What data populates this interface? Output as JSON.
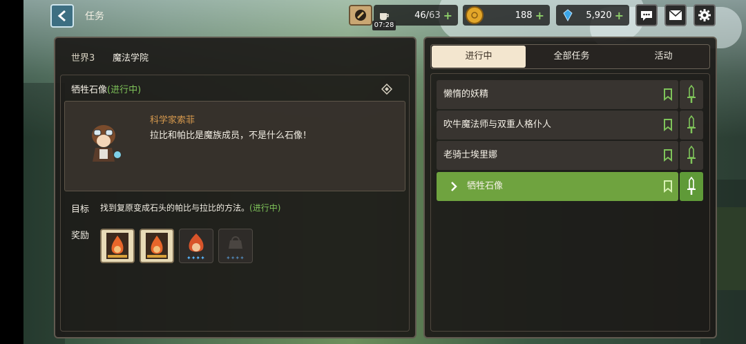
{
  "header": {
    "title": "任务",
    "stamina": {
      "current": "46",
      "max": "63",
      "timer": "07:28"
    },
    "gold": "188",
    "gems": "5,920"
  },
  "left_panel": {
    "world": "世界3",
    "location": "魔法学院",
    "quest_name": "牺牲石像",
    "quest_status": "(进行中)",
    "npc_name": "科学家索菲",
    "npc_line": "拉比和帕比是魔族成员，不是什么石像！",
    "goal_label": "目标",
    "goal_text": "找到复原变成石头的帕比与拉比的方法。",
    "goal_status": "(进行中)",
    "reward_label": "奖励",
    "rewards": [
      {
        "icon": "fire-hero-card-icon"
      },
      {
        "icon": "fire-hero-card-icon"
      },
      {
        "icon": "fire-hero-portrait-icon"
      },
      {
        "icon": "locked-hero-portrait-icon"
      }
    ]
  },
  "tabs": [
    {
      "label": "进行中",
      "active": true
    },
    {
      "label": "全部任务",
      "active": false
    },
    {
      "label": "活动",
      "active": false
    }
  ],
  "quests": [
    {
      "label": "懒惰的妖精",
      "active": false
    },
    {
      "label": "吹牛魔法师与双重人格仆人",
      "active": false
    },
    {
      "label": "老骑士埃里娜",
      "active": false
    },
    {
      "label": "牺牲石像",
      "active": true
    }
  ],
  "colors": {
    "active_green": "#6fa33f",
    "status_green": "#7fc45a",
    "npc_orange": "#d89a4e",
    "back_button": "#3d6f82"
  }
}
